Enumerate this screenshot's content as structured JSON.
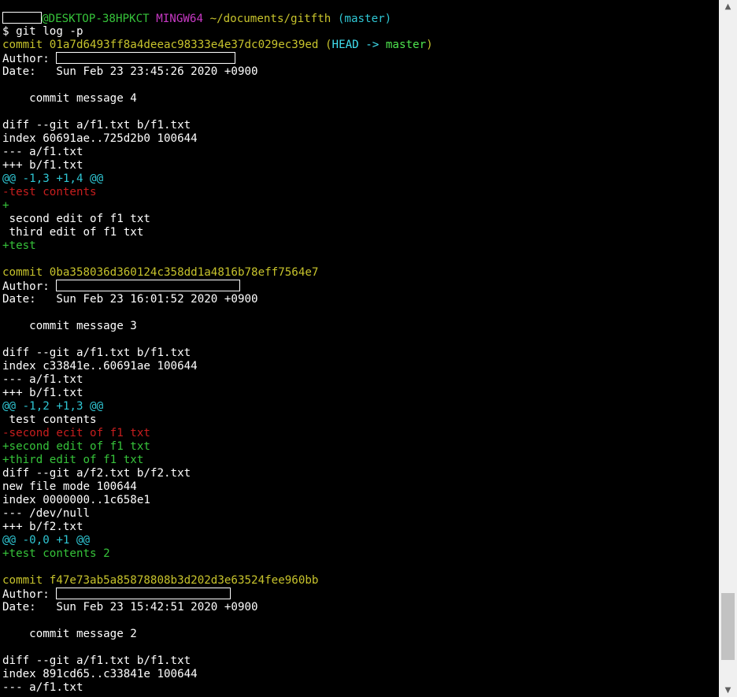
{
  "colors": {
    "default": "#ffffff",
    "green": "#36c33a",
    "magenta": "#c839c5",
    "yellow": "#c7c32c",
    "cyan": "#2fc6d3",
    "red": "#c81e1e",
    "boldcyan": "#40e0f0",
    "boldgreen": "#4ee44e"
  },
  "scrollbar": {
    "up_icon": "triangle-up-icon",
    "down_icon": "triangle-down-icon",
    "thumb_fraction": 0.1
  },
  "lines": [
    {
      "segs": [
        {
          "box": 48,
          "name": "redacted-username"
        },
        {
          "t": "@DESKTOP-38HPKCT",
          "c": "green"
        },
        {
          "t": " "
        },
        {
          "t": "MINGW64",
          "c": "magenta"
        },
        {
          "t": " "
        },
        {
          "t": "~/documents/gitfth",
          "c": "yellow"
        },
        {
          "t": " "
        },
        {
          "t": "(master)",
          "c": "cyan"
        }
      ]
    },
    {
      "segs": [
        {
          "t": "$ git log -p"
        }
      ]
    },
    {
      "segs": [
        {
          "t": "commit 01a7d6493ff8a4deeac98333e4e37dc029ec39ed (",
          "c": "yellow"
        },
        {
          "t": "HEAD -> ",
          "c": "boldcyan"
        },
        {
          "t": "master",
          "c": "boldgreen"
        },
        {
          "t": ")",
          "c": "yellow"
        }
      ]
    },
    {
      "segs": [
        {
          "t": "Author: "
        },
        {
          "box": 226,
          "name": "redacted-author"
        }
      ]
    },
    {
      "segs": [
        {
          "t": "Date:   Sun Feb 23 23:45:26 2020 +0900"
        }
      ]
    },
    {
      "segs": [
        {
          "t": ""
        }
      ]
    },
    {
      "segs": [
        {
          "t": "    commit message 4"
        }
      ]
    },
    {
      "segs": [
        {
          "t": ""
        }
      ]
    },
    {
      "segs": [
        {
          "t": "diff --git a/f1.txt b/f1.txt"
        }
      ]
    },
    {
      "segs": [
        {
          "t": "index 60691ae..725d2b0 100644"
        }
      ]
    },
    {
      "segs": [
        {
          "t": "--- a/f1.txt"
        }
      ]
    },
    {
      "segs": [
        {
          "t": "+++ b/f1.txt"
        }
      ]
    },
    {
      "segs": [
        {
          "t": "@@ -1,3 +1,4 @@",
          "c": "cyan"
        }
      ]
    },
    {
      "segs": [
        {
          "t": "-test contents",
          "c": "red"
        }
      ]
    },
    {
      "segs": [
        {
          "t": "+",
          "c": "green"
        }
      ]
    },
    {
      "segs": [
        {
          "t": " second edit of f1 txt"
        }
      ]
    },
    {
      "segs": [
        {
          "t": " third edit of f1 txt"
        }
      ]
    },
    {
      "segs": [
        {
          "t": "+test",
          "c": "green"
        }
      ]
    },
    {
      "segs": [
        {
          "t": ""
        }
      ]
    },
    {
      "segs": [
        {
          "t": "commit 0ba358036d360124c358dd1a4816b78eff7564e7",
          "c": "yellow"
        }
      ]
    },
    {
      "segs": [
        {
          "t": "Author: "
        },
        {
          "box": 232,
          "name": "redacted-author"
        }
      ]
    },
    {
      "segs": [
        {
          "t": "Date:   Sun Feb 23 16:01:52 2020 +0900"
        }
      ]
    },
    {
      "segs": [
        {
          "t": ""
        }
      ]
    },
    {
      "segs": [
        {
          "t": "    commit message 3"
        }
      ]
    },
    {
      "segs": [
        {
          "t": ""
        }
      ]
    },
    {
      "segs": [
        {
          "t": "diff --git a/f1.txt b/f1.txt"
        }
      ]
    },
    {
      "segs": [
        {
          "t": "index c33841e..60691ae 100644"
        }
      ]
    },
    {
      "segs": [
        {
          "t": "--- a/f1.txt"
        }
      ]
    },
    {
      "segs": [
        {
          "t": "+++ b/f1.txt"
        }
      ]
    },
    {
      "segs": [
        {
          "t": "@@ -1,2 +1,3 @@",
          "c": "cyan"
        }
      ]
    },
    {
      "segs": [
        {
          "t": " test contents"
        }
      ]
    },
    {
      "segs": [
        {
          "t": "-second ecit of f1 txt",
          "c": "red"
        }
      ]
    },
    {
      "segs": [
        {
          "t": "+second edit of f1 txt",
          "c": "green"
        }
      ]
    },
    {
      "segs": [
        {
          "t": "+third edit of f1 txt",
          "c": "green"
        }
      ]
    },
    {
      "segs": [
        {
          "t": "diff --git a/f2.txt b/f2.txt"
        }
      ]
    },
    {
      "segs": [
        {
          "t": "new file mode 100644"
        }
      ]
    },
    {
      "segs": [
        {
          "t": "index 0000000..1c658e1"
        }
      ]
    },
    {
      "segs": [
        {
          "t": "--- /dev/null"
        }
      ]
    },
    {
      "segs": [
        {
          "t": "+++ b/f2.txt"
        }
      ]
    },
    {
      "segs": [
        {
          "t": "@@ -0,0 +1 @@",
          "c": "cyan"
        }
      ]
    },
    {
      "segs": [
        {
          "t": "+test contents 2",
          "c": "green"
        }
      ]
    },
    {
      "segs": [
        {
          "t": ""
        }
      ]
    },
    {
      "segs": [
        {
          "t": "commit f47e73ab5a85878808b3d202d3e63524fee960bb",
          "c": "yellow"
        }
      ]
    },
    {
      "segs": [
        {
          "t": "Author: "
        },
        {
          "box": 220,
          "name": "redacted-author"
        }
      ]
    },
    {
      "segs": [
        {
          "t": "Date:   Sun Feb 23 15:42:51 2020 +0900"
        }
      ]
    },
    {
      "segs": [
        {
          "t": ""
        }
      ]
    },
    {
      "segs": [
        {
          "t": "    commit message 2"
        }
      ]
    },
    {
      "segs": [
        {
          "t": ""
        }
      ]
    },
    {
      "segs": [
        {
          "t": "diff --git a/f1.txt b/f1.txt"
        }
      ]
    },
    {
      "segs": [
        {
          "t": "index 891cd65..c33841e 100644"
        }
      ]
    },
    {
      "segs": [
        {
          "t": "--- a/f1.txt"
        }
      ]
    }
  ]
}
